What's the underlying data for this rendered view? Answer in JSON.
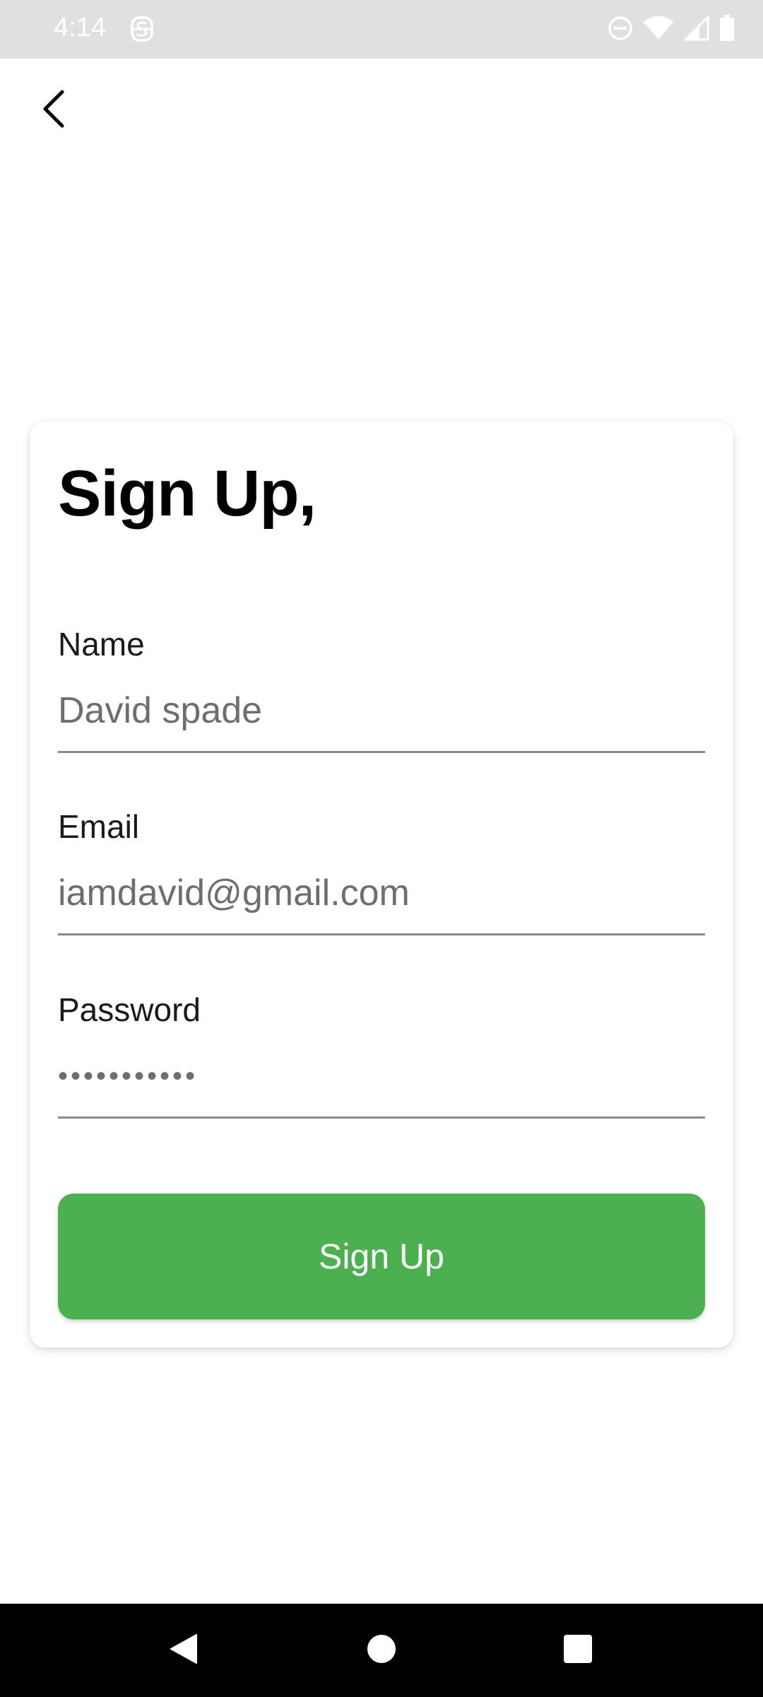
{
  "status_bar": {
    "time": "4:14",
    "icons": [
      "notification-s-icon",
      "do-not-disturb-icon",
      "wifi-icon",
      "cell-signal-icon",
      "battery-icon"
    ]
  },
  "top_bar": {
    "back_icon": "chevron-left-icon"
  },
  "form": {
    "title": "Sign Up,",
    "fields": [
      {
        "label": "Name",
        "value": "David spade",
        "type": "text"
      },
      {
        "label": "Email",
        "value": "iamdavid@gmail.com",
        "type": "email"
      },
      {
        "label": "Password",
        "value": "•••••••••••",
        "type": "password"
      }
    ],
    "submit_label": "Sign Up"
  },
  "nav_bar": {
    "buttons": [
      "back-triangle-icon",
      "home-circle-icon",
      "recents-square-icon"
    ]
  },
  "colors": {
    "accent": "#4caf50",
    "status_bar_bg": "#e0e0e0",
    "nav_bar_bg": "#000000",
    "text_primary": "#000000",
    "input_text": "#6e6e6e"
  }
}
